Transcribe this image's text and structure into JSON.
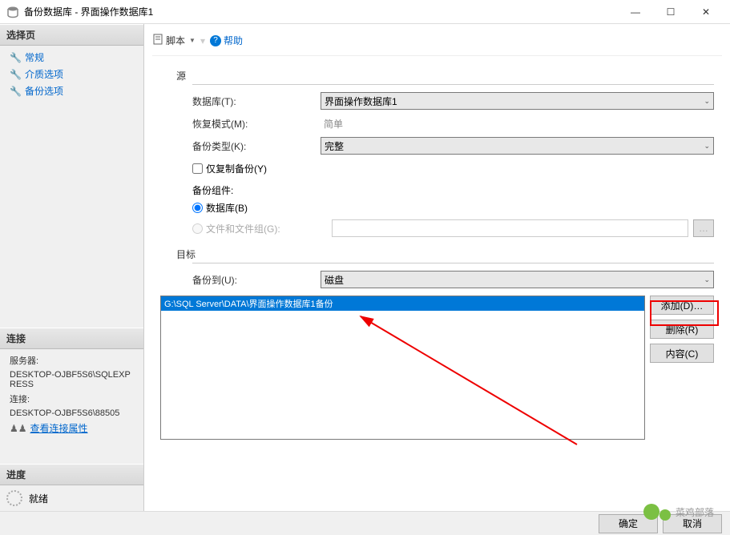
{
  "window": {
    "title": "备份数据库 - 界面操作数据库1",
    "minimize": "—",
    "maximize": "☐",
    "close": "✕"
  },
  "sidebar": {
    "select_page": "选择页",
    "nav": [
      {
        "label": "常规"
      },
      {
        "label": "介质选项"
      },
      {
        "label": "备份选项"
      }
    ],
    "connection_header": "连接",
    "server_label": "服务器:",
    "server_value": "DESKTOP-OJBF5S6\\SQLEXPRESS",
    "conn_label": "连接:",
    "conn_value": "DESKTOP-OJBF5S6\\88505",
    "view_conn_props": "查看连接属性",
    "progress_header": "进度",
    "status": "就绪"
  },
  "toolbar": {
    "script_label": "脚本",
    "help_label": "帮助"
  },
  "form": {
    "source_header": "源",
    "database_label": "数据库(T):",
    "database_value": "界面操作数据库1",
    "recovery_label": "恢复模式(M):",
    "recovery_value": "简单",
    "backup_type_label": "备份类型(K):",
    "backup_type_value": "完整",
    "copy_only_label": "仅复制备份(Y)",
    "component_header": "备份组件:",
    "radio_db": "数据库(B)",
    "radio_files": "文件和文件组(G):",
    "dest_header": "目标",
    "backup_to_label": "备份到(U):",
    "backup_to_value": "磁盘",
    "dest_items": [
      "G:\\SQL Server\\DATA\\界面操作数据库1备份"
    ],
    "add_btn": "添加(D)…",
    "remove_btn": "删除(R)",
    "contents_btn": "内容(C)"
  },
  "footer": {
    "ok": "确定",
    "cancel": "取消"
  },
  "watermark": "菜鸡部落"
}
